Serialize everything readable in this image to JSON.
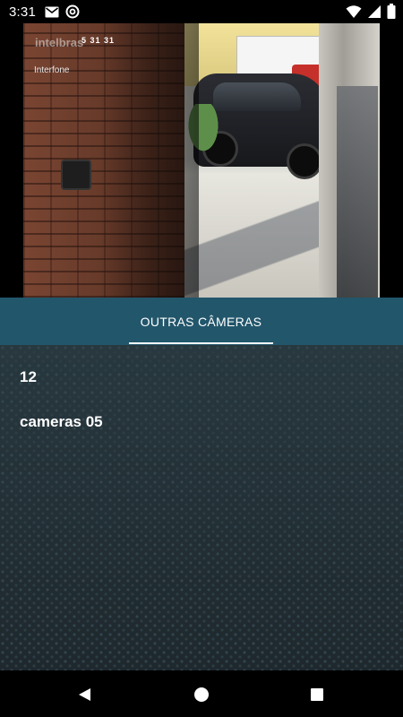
{
  "status_bar": {
    "time": "3:31",
    "left_icons": [
      "gmail-icon",
      "at-sign-icon"
    ],
    "right_icons": [
      "wifi-icon",
      "signal-icon",
      "battery-icon"
    ]
  },
  "camera": {
    "brand_overlay": "intelbras",
    "timestamp_overlay": "5 31 31",
    "camera_label": "Interfone"
  },
  "tabs": [
    {
      "label": "OUTRAS CÂMERAS",
      "selected": true
    }
  ],
  "list": {
    "items": [
      {
        "label": "12"
      },
      {
        "label": "cameras 05"
      }
    ]
  },
  "nav_bar": {
    "buttons": [
      "back-icon",
      "home-icon",
      "recents-icon"
    ]
  },
  "colors": {
    "tab_bar": "#22566b",
    "list_background": "#1f2a30",
    "text": "#ffffff"
  }
}
